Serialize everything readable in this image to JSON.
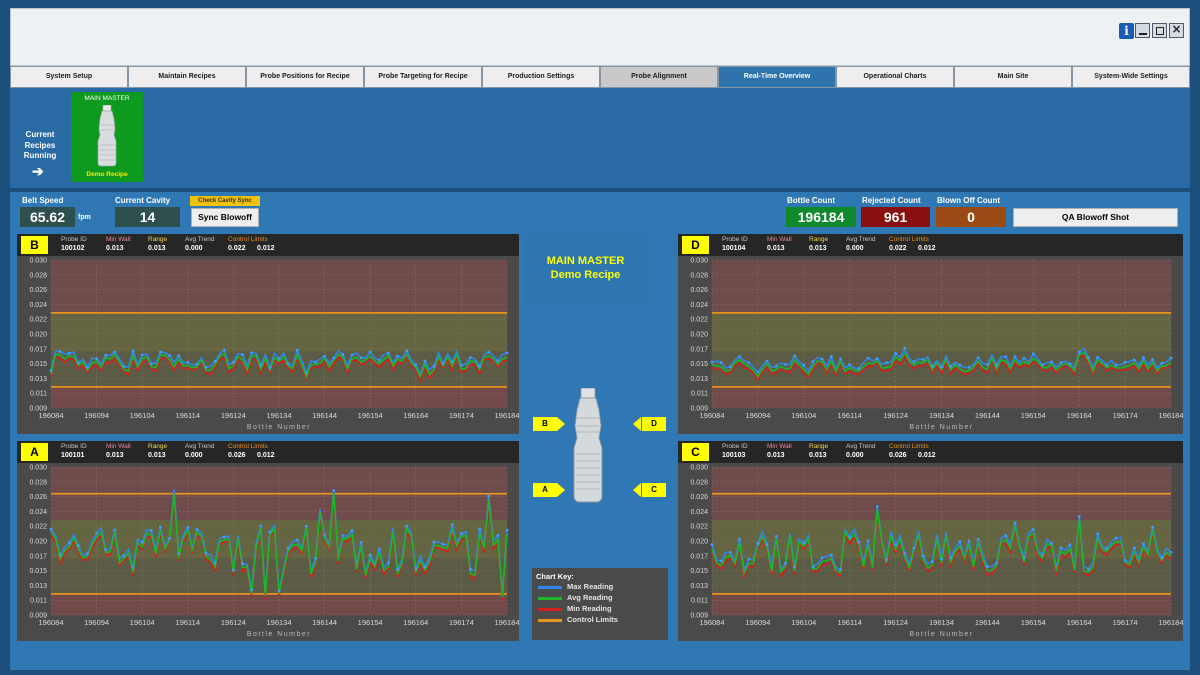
{
  "window": {
    "info_icon": "info-icon",
    "controls": [
      "minimize-icon",
      "maximize-icon",
      "close-icon"
    ]
  },
  "tabs": [
    {
      "label": "System Setup",
      "state": "normal"
    },
    {
      "label": "Maintain Recipes",
      "state": "normal"
    },
    {
      "label": "Probe Positions for Recipe",
      "state": "normal"
    },
    {
      "label": "Probe Targeting for Recipe",
      "state": "normal"
    },
    {
      "label": "Production Settings",
      "state": "normal"
    },
    {
      "label": "Probe Alignment",
      "state": "grey"
    },
    {
      "label": "Real-Time Overview",
      "state": "active"
    },
    {
      "label": "Operational Charts",
      "state": "normal"
    },
    {
      "label": "Main Site",
      "state": "normal"
    },
    {
      "label": "System-Wide Settings",
      "state": "normal"
    }
  ],
  "recipes": {
    "current_label": "Current Recipes Running",
    "arrow_icon": "arrow-right-icon",
    "tile": {
      "title": "MAIN MASTER",
      "name": "Demo Recipe"
    }
  },
  "stats": {
    "belt_speed_label": "Belt Speed",
    "belt_speed_value": "65.62",
    "belt_speed_unit": "fpm",
    "cavity_label": "Current Cavity",
    "cavity_value": "14",
    "check_cavity_sync": "Check Cavity Sync",
    "sync_blowoff": "Sync Blowoff",
    "bottle_count_label": "Bottle Count",
    "bottle_count_value": "196184",
    "rejected_label": "Rejected Count",
    "rejected_value": "961",
    "blown_off_label": "Blown Off Count",
    "blown_off_value": "0",
    "qa_button": "QA Blowoff Shot"
  },
  "colors": {
    "max": "#2f86e8",
    "avg": "#1fb42a",
    "min": "#d21f1f",
    "control": "#e8931e",
    "bottle_green": "#0e8a2c",
    "rejected": "#8a1010",
    "blown": "#9b4a14"
  },
  "header_labels": {
    "probe": "Probe ID",
    "min": "Min Wall",
    "range": "Range",
    "avg": "Avg Trend",
    "control": "Control Limits"
  },
  "center": {
    "title": "MAIN MASTER",
    "subtitle": "Demo Recipe",
    "probe_labels": [
      "B",
      "D",
      "A",
      "C"
    ]
  },
  "chart_key": {
    "title": "Chart Key:",
    "items": [
      {
        "label": "Max Reading",
        "color": "#2f86e8"
      },
      {
        "label": "Avg Reading",
        "color": "#1fb42a"
      },
      {
        "label": "Min Reading",
        "color": "#d21f1f"
      },
      {
        "label": "Control Limits",
        "color": "#e8931e"
      }
    ]
  },
  "chart_data": [
    {
      "type": "line",
      "probe": "B",
      "probe_id": "100102",
      "min_wall": "0.013",
      "range": "0.013",
      "avg_trend": "0.000",
      "control_low": "0.022",
      "control_high": "0.012",
      "xlabel": "Bottle Number",
      "ylabel": "",
      "xlim": [
        196084,
        196184
      ],
      "ylim": [
        0.009,
        0.03
      ],
      "yticks": [
        "0.030",
        "0.028",
        "0.026",
        "0.024",
        "0.022",
        "0.020",
        "0.017",
        "0.015",
        "0.013",
        "0.011",
        "0.009"
      ],
      "xticks": [
        "196084",
        "196094",
        "196104",
        "196114",
        "196124",
        "196134",
        "196144",
        "196154",
        "196164",
        "196174",
        "196184"
      ],
      "control_limits": [
        0.0225,
        0.012
      ],
      "seed": 3,
      "center": 0.0155,
      "amp": 0.0012,
      "series": [
        {
          "name": "Max Reading"
        },
        {
          "name": "Avg Reading"
        },
        {
          "name": "Min Reading"
        }
      ]
    },
    {
      "type": "line",
      "probe": "D",
      "probe_id": "100104",
      "min_wall": "0.013",
      "range": "0.013",
      "avg_trend": "0.000",
      "control_low": "0.022",
      "control_high": "0.012",
      "xlabel": "Bottle Number",
      "ylabel": "",
      "xlim": [
        196084,
        196184
      ],
      "ylim": [
        0.009,
        0.03
      ],
      "yticks": [
        "0.030",
        "0.028",
        "0.026",
        "0.024",
        "0.022",
        "0.020",
        "0.017",
        "0.015",
        "0.013",
        "0.011",
        "0.009"
      ],
      "xticks": [
        "196084",
        "196094",
        "196104",
        "196114",
        "196124",
        "196134",
        "196144",
        "196154",
        "196164",
        "196174",
        "196184"
      ],
      "control_limits": [
        0.0225,
        0.012
      ],
      "seed": 7,
      "center": 0.015,
      "amp": 0.0009,
      "series": [
        {
          "name": "Max Reading"
        },
        {
          "name": "Avg Reading"
        },
        {
          "name": "Min Reading"
        }
      ]
    },
    {
      "type": "line",
      "probe": "A",
      "probe_id": "100101",
      "min_wall": "0.013",
      "range": "0.013",
      "avg_trend": "0.000",
      "control_low": "0.026",
      "control_high": "0.012",
      "xlabel": "Bottle Number",
      "ylabel": "",
      "xlim": [
        196084,
        196184
      ],
      "ylim": [
        0.009,
        0.03
      ],
      "yticks": [
        "0.030",
        "0.028",
        "0.026",
        "0.024",
        "0.022",
        "0.020",
        "0.017",
        "0.015",
        "0.013",
        "0.011",
        "0.009"
      ],
      "xticks": [
        "196084",
        "196094",
        "196104",
        "196114",
        "196124",
        "196134",
        "196144",
        "196154",
        "196164",
        "196174",
        "196184"
      ],
      "control_limits": [
        0.0262,
        0.012
      ],
      "seed": 11,
      "center": 0.018,
      "amp": 0.0035,
      "series": [
        {
          "name": "Max Reading"
        },
        {
          "name": "Avg Reading"
        },
        {
          "name": "Min Reading"
        }
      ]
    },
    {
      "type": "line",
      "probe": "C",
      "probe_id": "100103",
      "min_wall": "0.013",
      "range": "0.013",
      "avg_trend": "0.000",
      "control_low": "0.026",
      "control_high": "0.012",
      "xlabel": "Bottle Number",
      "ylabel": "",
      "xlim": [
        196084,
        196184
      ],
      "ylim": [
        0.009,
        0.03
      ],
      "yticks": [
        "0.030",
        "0.028",
        "0.026",
        "0.024",
        "0.022",
        "0.020",
        "0.017",
        "0.015",
        "0.013",
        "0.011",
        "0.009"
      ],
      "xticks": [
        "196084",
        "196094",
        "196104",
        "196114",
        "196124",
        "196134",
        "196144",
        "196154",
        "196164",
        "196174",
        "196184"
      ],
      "control_limits": [
        0.0262,
        0.012
      ],
      "seed": 19,
      "center": 0.0178,
      "amp": 0.003,
      "series": [
        {
          "name": "Max Reading"
        },
        {
          "name": "Avg Reading"
        },
        {
          "name": "Min Reading"
        }
      ]
    }
  ]
}
